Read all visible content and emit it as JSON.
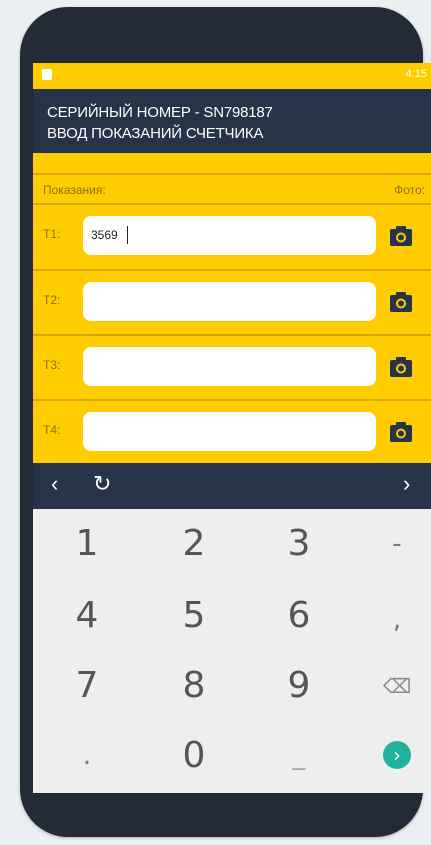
{
  "status_bar": {
    "time": "4:15",
    "indicators": "✈ ▮"
  },
  "app_bar": {
    "line1": "СЕРИЙНЫЙ НОМЕР - SN798187",
    "line2": "ВВОД ПОКАЗАНИЙ СЧЕТЧИКА"
  },
  "form": {
    "readings_label": "Показания:",
    "photo_label": "Фото:",
    "rows": [
      {
        "label": "T1:",
        "value": "3569"
      },
      {
        "label": "T2:",
        "value": ""
      },
      {
        "label": "T3:",
        "value": ""
      },
      {
        "label": "T4:",
        "value": ""
      }
    ]
  },
  "nav": {
    "prev": "‹",
    "refresh": "↻",
    "next": "›"
  },
  "keyboard": {
    "keys": [
      "1",
      "2",
      "3",
      "-",
      "4",
      "5",
      "6",
      ",",
      "7",
      "8",
      "9",
      "⌫",
      ".",
      "0",
      "_",
      "›"
    ]
  },
  "colors": {
    "accent": "#ffcc00",
    "dark": "#273347",
    "go": "#20b39a"
  }
}
